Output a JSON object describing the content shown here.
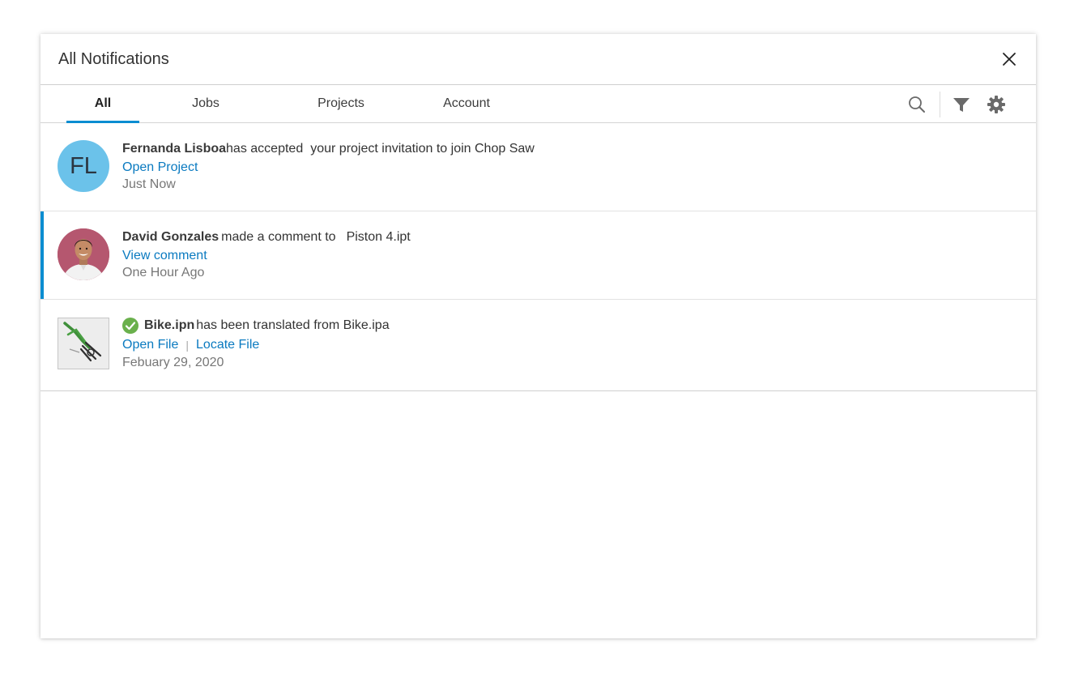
{
  "header": {
    "title": "All Notifications"
  },
  "tabs": [
    {
      "label": "All",
      "active": true
    },
    {
      "label": "Jobs",
      "active": false
    },
    {
      "label": "Projects",
      "active": false
    },
    {
      "label": "Account",
      "active": false
    }
  ],
  "toolbar": {
    "icons": [
      "search-icon",
      "filter-icon",
      "gear-icon"
    ]
  },
  "notifications": [
    {
      "avatar_initials": "FL",
      "avatar_color": "#6bc2ea",
      "name": "Fernanda Lisboa",
      "action": "has accepted",
      "detail": "your project invitation to join Chop Saw",
      "link": "Open Project",
      "time": "Just Now",
      "unread": false
    },
    {
      "avatar_icon": "user-photo-avatar",
      "avatar_color": "#b5576f",
      "name": "David Gonzales",
      "action": "made a comment to",
      "detail": "Piston 4.ipt",
      "link": "View comment",
      "time": "One Hour Ago",
      "unread": true
    },
    {
      "thumbnail_icon": "bike-model-thumbnail",
      "status_icon": "check-circle-icon",
      "status_color": "#6ab04c",
      "name": "Bike.ipn",
      "action": "has been translated from Bike.ipa",
      "links": [
        "Open File",
        "Locate File"
      ],
      "link_separator": "|",
      "time": "Febuary 29, 2020",
      "unread": false
    }
  ],
  "colors": {
    "accent": "#0a8dd1",
    "link": "#0a7ac0"
  }
}
